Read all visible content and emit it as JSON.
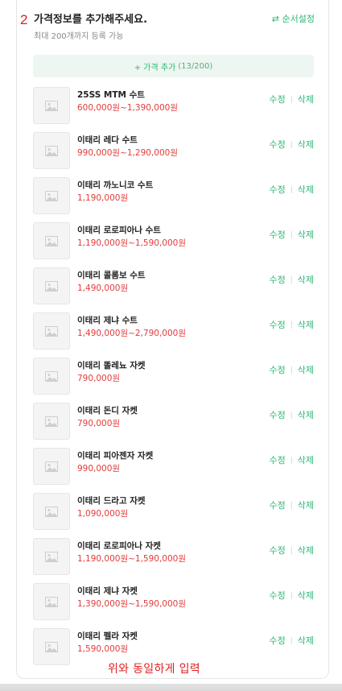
{
  "header": {
    "step_number": "2",
    "title": "가격정보를 추가해주세요.",
    "subtitle": "최대 200개까지 등록 가능",
    "reorder_label": "⇄ 순서설정"
  },
  "add_button": {
    "label": "+ 가격 추가",
    "count": "(13/200)"
  },
  "actions": {
    "edit_label": "수정",
    "separator": "|",
    "delete_label": "삭제"
  },
  "items": [
    {
      "name": "25SS MTM 수트",
      "price": "600,000원~1,390,000원"
    },
    {
      "name": "이태리 레다 수트",
      "price": "990,000원~1,290,000원"
    },
    {
      "name": "이태리 까노니코 수트",
      "price": "1,190,000원"
    },
    {
      "name": "이태리 로로피아나 수트",
      "price": "1,190,000원~1,590,000원"
    },
    {
      "name": "이태리 콜롬보 수트",
      "price": "1,490,000원"
    },
    {
      "name": "이태리 제냐 수트",
      "price": "1,490,000원~2,790,000원"
    },
    {
      "name": "이태리 똘레뇨 자켓",
      "price": "790,000원"
    },
    {
      "name": "이태리 돈디 자켓",
      "price": "790,000원"
    },
    {
      "name": "이태리 피아젠자 자켓",
      "price": "990,000원"
    },
    {
      "name": "이태리 드라고 자켓",
      "price": "1,090,000원"
    },
    {
      "name": "이태리 로로피아나 자켓",
      "price": "1,190,000원~1,590,000원"
    },
    {
      "name": "이태리 제냐 자켓",
      "price": "1,390,000원~1,590,000원"
    },
    {
      "name": "이태리 펠라 자켓",
      "price": "1,590,000원"
    }
  ],
  "annotation": "위와 동일하게 입력",
  "colors": {
    "accent": "#2bb673",
    "price": "#e23b3b",
    "annotation": "#e02020"
  },
  "icons": {
    "thumbnail": "image-placeholder-icon",
    "reorder": "swap-arrows-icon"
  }
}
